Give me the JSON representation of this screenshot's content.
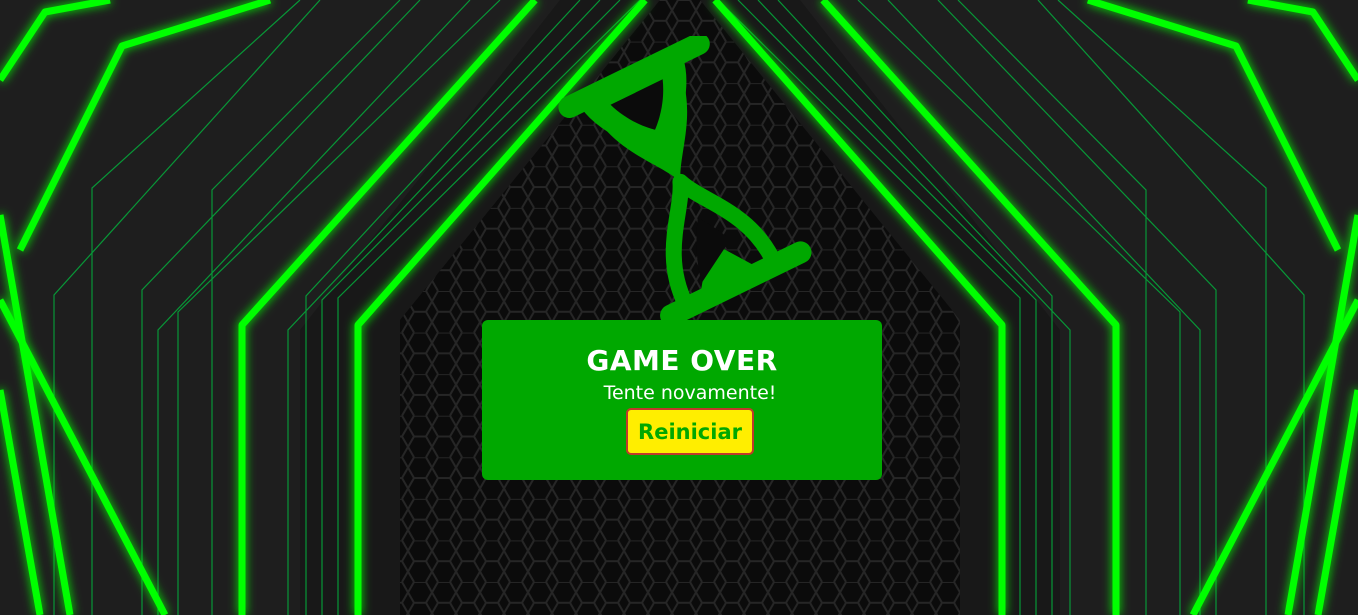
{
  "game_over": {
    "title": "GAME OVER",
    "subtitle": "Tente novamente!",
    "restart_label": "Reiniciar"
  },
  "colors": {
    "neon": "#00ff00",
    "panel": "#00a800",
    "hourglass": "#00a800",
    "button_bg": "#ffee00",
    "button_text": "#00a800",
    "button_border": "#c0392b",
    "background": "#151515"
  },
  "icons": {
    "timer": "hourglass-icon"
  }
}
